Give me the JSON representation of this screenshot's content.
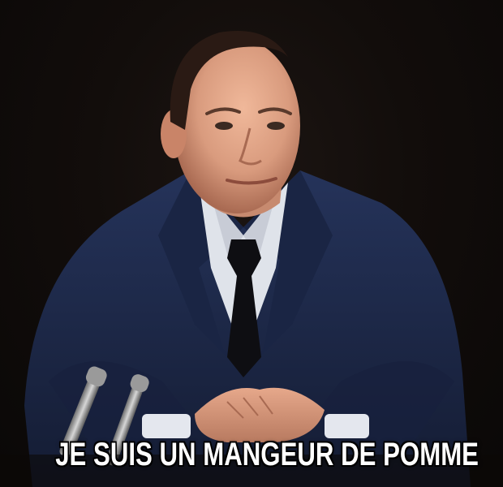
{
  "meme": {
    "caption": "JE SUIS UN MANGEUR DE POMME"
  },
  "colors": {
    "background": "#0d0908",
    "suit": "#1e2a4a",
    "shirt": "#dfe3ea",
    "tie": "#0e0e12",
    "skin": "#d99b7e",
    "hair": "#2a1a14",
    "caption_text": "#ffffff"
  }
}
